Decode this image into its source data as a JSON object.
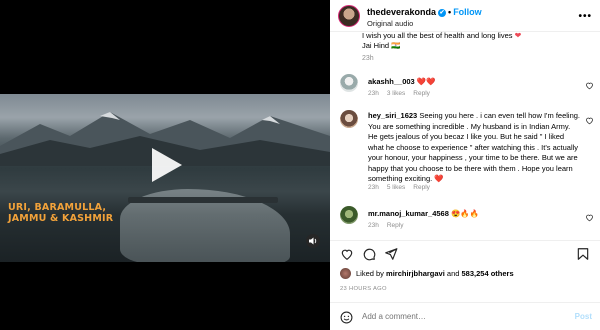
{
  "video": {
    "caption_lines": [
      "URI, BARAMULLA,",
      "JAMMU & KASHMIR"
    ]
  },
  "header": {
    "username": "thedeverakonda",
    "verified_mark": "✔",
    "separator": "•",
    "follow_label": "Follow",
    "audio_label": "Original audio",
    "more_label": "•••"
  },
  "top_comment": {
    "cut_text": "I wish you all the best of health and long lives ",
    "line2": "Jai Hind 🇮🇳",
    "time": "23h"
  },
  "comments": [
    {
      "username": "akashh__003",
      "text": "❤️❤️",
      "time": "23h",
      "likes": "3 likes",
      "reply": "Reply"
    },
    {
      "username": "hey_siri_1623",
      "text": "Seeing you here . i can even tell how I'm feeling. You are something incredible . My husband is in Indian Army. He gets jealous of you becaz I like you. But he said \" I liked what he choose to experience \" after watching this . It's actually your honour, your happiness , your time to be there. But we are happy that you choose to be there with them . Hope you learn something exciting. ❤️",
      "time": "23h",
      "likes": "5 likes",
      "reply": "Reply"
    },
    {
      "username": "mr.manoj_kumar_4568",
      "text": "😍🔥🔥",
      "time": "23h",
      "likes": "",
      "reply": "Reply"
    }
  ],
  "likes": {
    "prefix": "Liked by ",
    "user": "mirchirjbhargavi",
    "mid": " and ",
    "count": "583,254 others"
  },
  "time_ago": "23 HOURS AGO",
  "add_comment": {
    "placeholder": "Add a comment…",
    "post_label": "Post"
  },
  "colors": {
    "accent": "#0095f6",
    "caption": "#f2a23a"
  }
}
